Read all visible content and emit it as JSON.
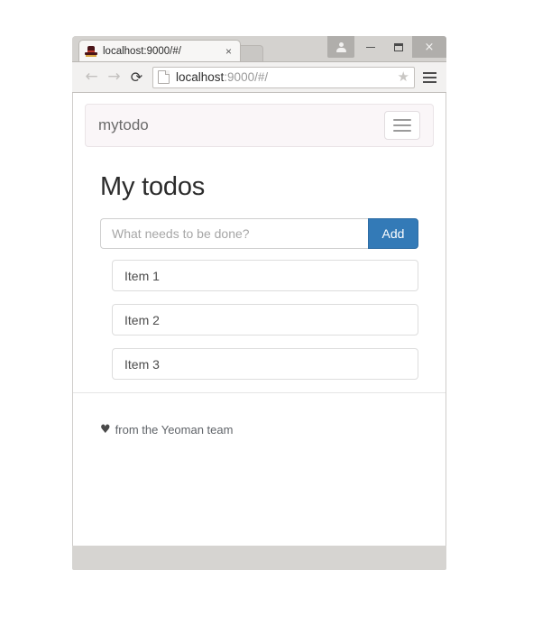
{
  "browser": {
    "window_controls": {
      "avatar_icon": "person-avatar-icon",
      "minimize_label": "—",
      "maximize_label": "□",
      "close_label": "×"
    },
    "tab": {
      "title": "localhost:9000/#/",
      "favicon": "yeoman-hat-icon",
      "close_label": "×"
    },
    "new_tab_label": "",
    "toolbar": {
      "back_label": "←",
      "forward_label": "→",
      "reload_label": "⟳",
      "page_icon": "page-document-icon",
      "url_host": "localhost",
      "url_rest": ":9000/#/",
      "bookmark_label": "★",
      "menu_icon": "hamburger-menu-icon"
    }
  },
  "page": {
    "navbar": {
      "brand": "mytodo",
      "toggle_icon": "hamburger-toggle-icon"
    },
    "title": "My todos",
    "form": {
      "placeholder": "What needs to be done?",
      "value": "",
      "add_label": "Add"
    },
    "todos": [
      {
        "label": "Item 1"
      },
      {
        "label": "Item 2"
      },
      {
        "label": "Item 3"
      }
    ],
    "footer": {
      "heart": "♥",
      "text": "from the Yeoman team"
    }
  },
  "colors": {
    "primary": "#337ab7",
    "navbar_bg": "#faf6f8",
    "chrome_bg": "#d6d4d1"
  }
}
